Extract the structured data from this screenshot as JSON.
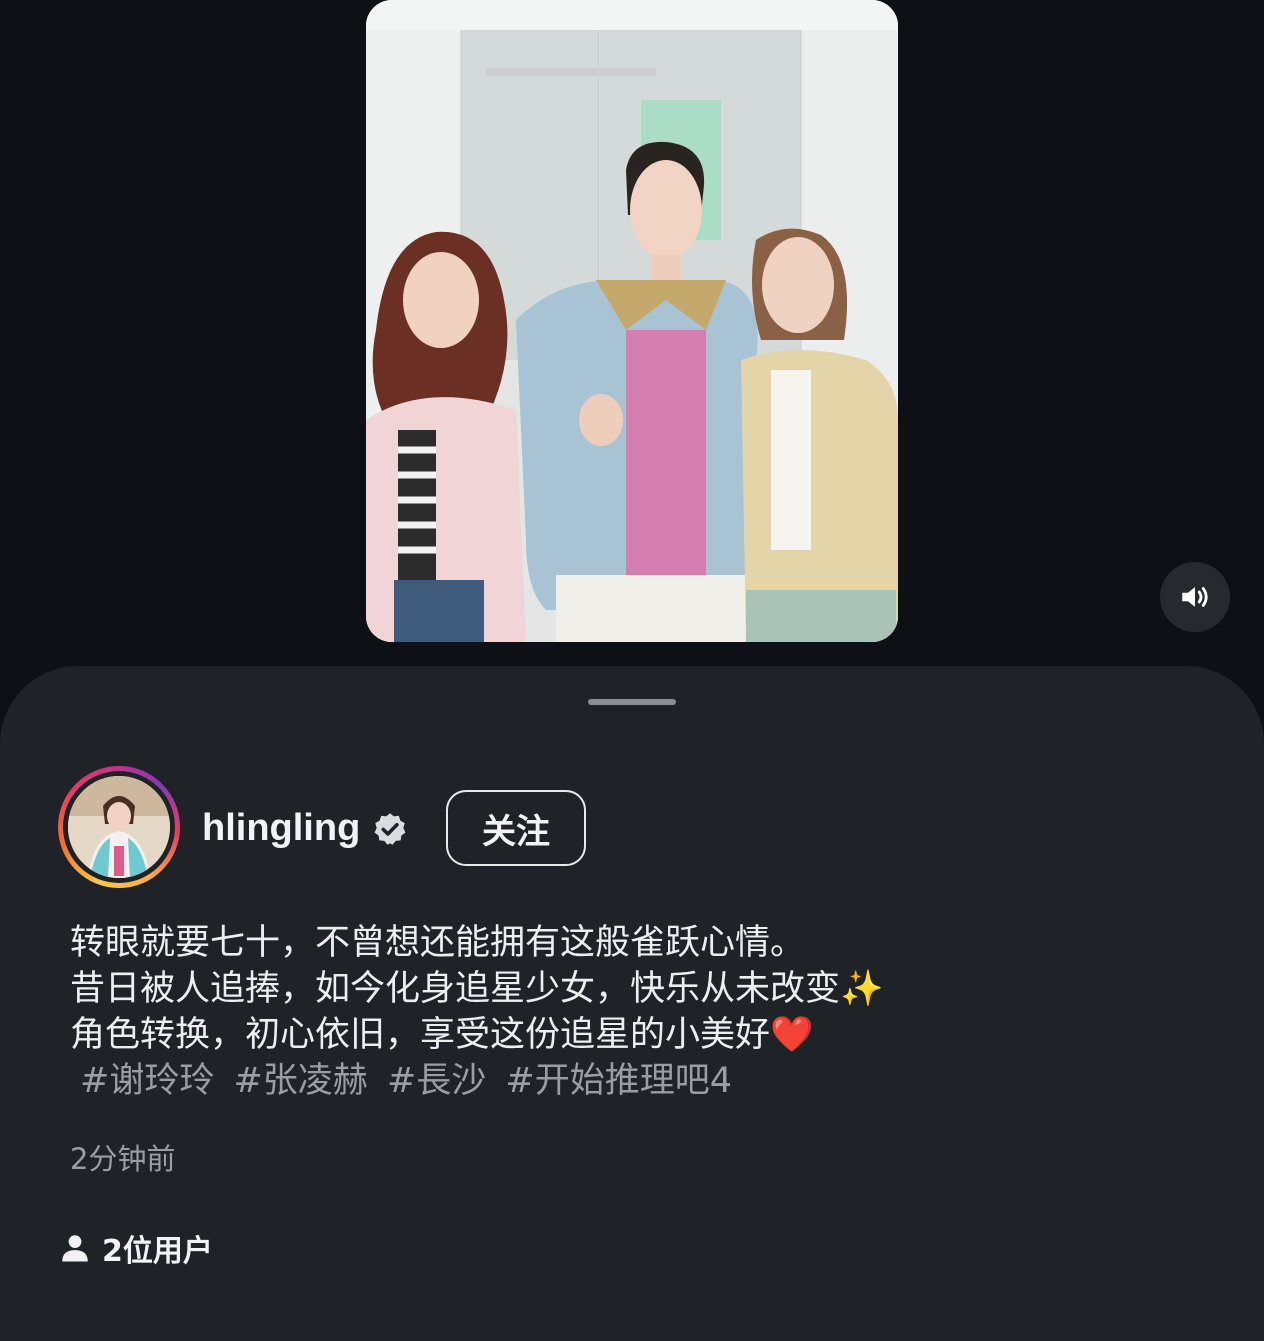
{
  "post": {
    "username": "hlingling",
    "verified": true,
    "follow_label": "关注",
    "caption_lines": [
      "转眼就要七十，不曾想还能拥有这般雀跃心情。",
      "昔日被人追捧，如今化身追星少女，快乐从未改变✨",
      "角色转换，初心依旧，享受这份追星的小美好❤️"
    ],
    "hashtags": [
      "#谢玲玲",
      "#张凌赫",
      "#長沙",
      "#开始推理吧4"
    ],
    "timestamp": "2分钟前",
    "tagged_users": "2位用户"
  },
  "icons": {
    "sound": "speaker-on-icon",
    "verified": "verified-badge-icon",
    "tagged": "person-icon"
  },
  "colors": {
    "background": "#0d1115",
    "sheet": "#1f2328",
    "text": "#f2f3f5",
    "muted": "#9a9da2"
  }
}
